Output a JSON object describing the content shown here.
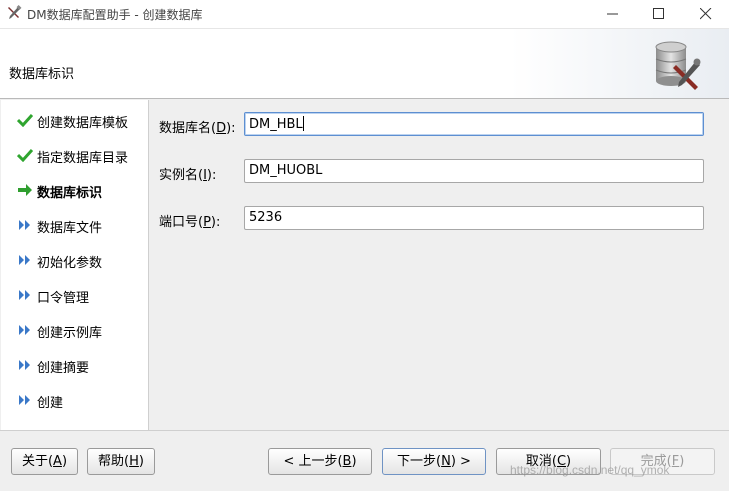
{
  "window": {
    "title": "DM数据库配置助手 - 创建数据库",
    "controls": {
      "minimize": "minimize",
      "maximize": "maximize",
      "close": "close"
    }
  },
  "header": {
    "title": "数据库标识",
    "logo_icon": "database-tools-icon"
  },
  "steps": [
    {
      "label": "创建数据库模板",
      "state": "done",
      "icon": "check-icon"
    },
    {
      "label": "指定数据库目录",
      "state": "done",
      "icon": "check-icon"
    },
    {
      "label": "数据库标识",
      "state": "current",
      "icon": "arrow-right-icon"
    },
    {
      "label": "数据库文件",
      "state": "pending",
      "icon": "double-chevron-icon"
    },
    {
      "label": "初始化参数",
      "state": "pending",
      "icon": "double-chevron-icon"
    },
    {
      "label": "口令管理",
      "state": "pending",
      "icon": "double-chevron-icon"
    },
    {
      "label": "创建示例库",
      "state": "pending",
      "icon": "double-chevron-icon"
    },
    {
      "label": "创建摘要",
      "state": "pending",
      "icon": "double-chevron-icon"
    },
    {
      "label": "创建",
      "state": "pending",
      "icon": "double-chevron-icon"
    }
  ],
  "form": {
    "db_name": {
      "label_pre": "数据库名(",
      "mnemonic": "D",
      "label_post": "):",
      "value": "DM_HBL"
    },
    "instance_name": {
      "label_pre": "实例名(",
      "mnemonic": "I",
      "label_post": "):",
      "value": "DM_HUOBL"
    },
    "port": {
      "label_pre": "端口号(",
      "mnemonic": "P",
      "label_post": "):",
      "value": "5236"
    }
  },
  "buttons": {
    "about": {
      "pre": "关于(",
      "mnemonic": "A",
      "post": ")"
    },
    "help": {
      "pre": "帮助(",
      "mnemonic": "H",
      "post": ")"
    },
    "back": {
      "pre": "< 上一步(",
      "mnemonic": "B",
      "post": ")"
    },
    "next": {
      "pre": "下一步(",
      "mnemonic": "N",
      "post": ") >"
    },
    "cancel": {
      "pre": "取消(",
      "mnemonic": "C",
      "post": ")"
    },
    "finish": {
      "pre": "完成(",
      "mnemonic": "F",
      "post": ")"
    }
  },
  "watermark": "https://blog.csdn.net/qq_ymok",
  "colors": {
    "check": "#2fa52f",
    "arrow": "#2f9e2f",
    "chevron": "#3a78c8",
    "focus": "#5d8fd1"
  }
}
